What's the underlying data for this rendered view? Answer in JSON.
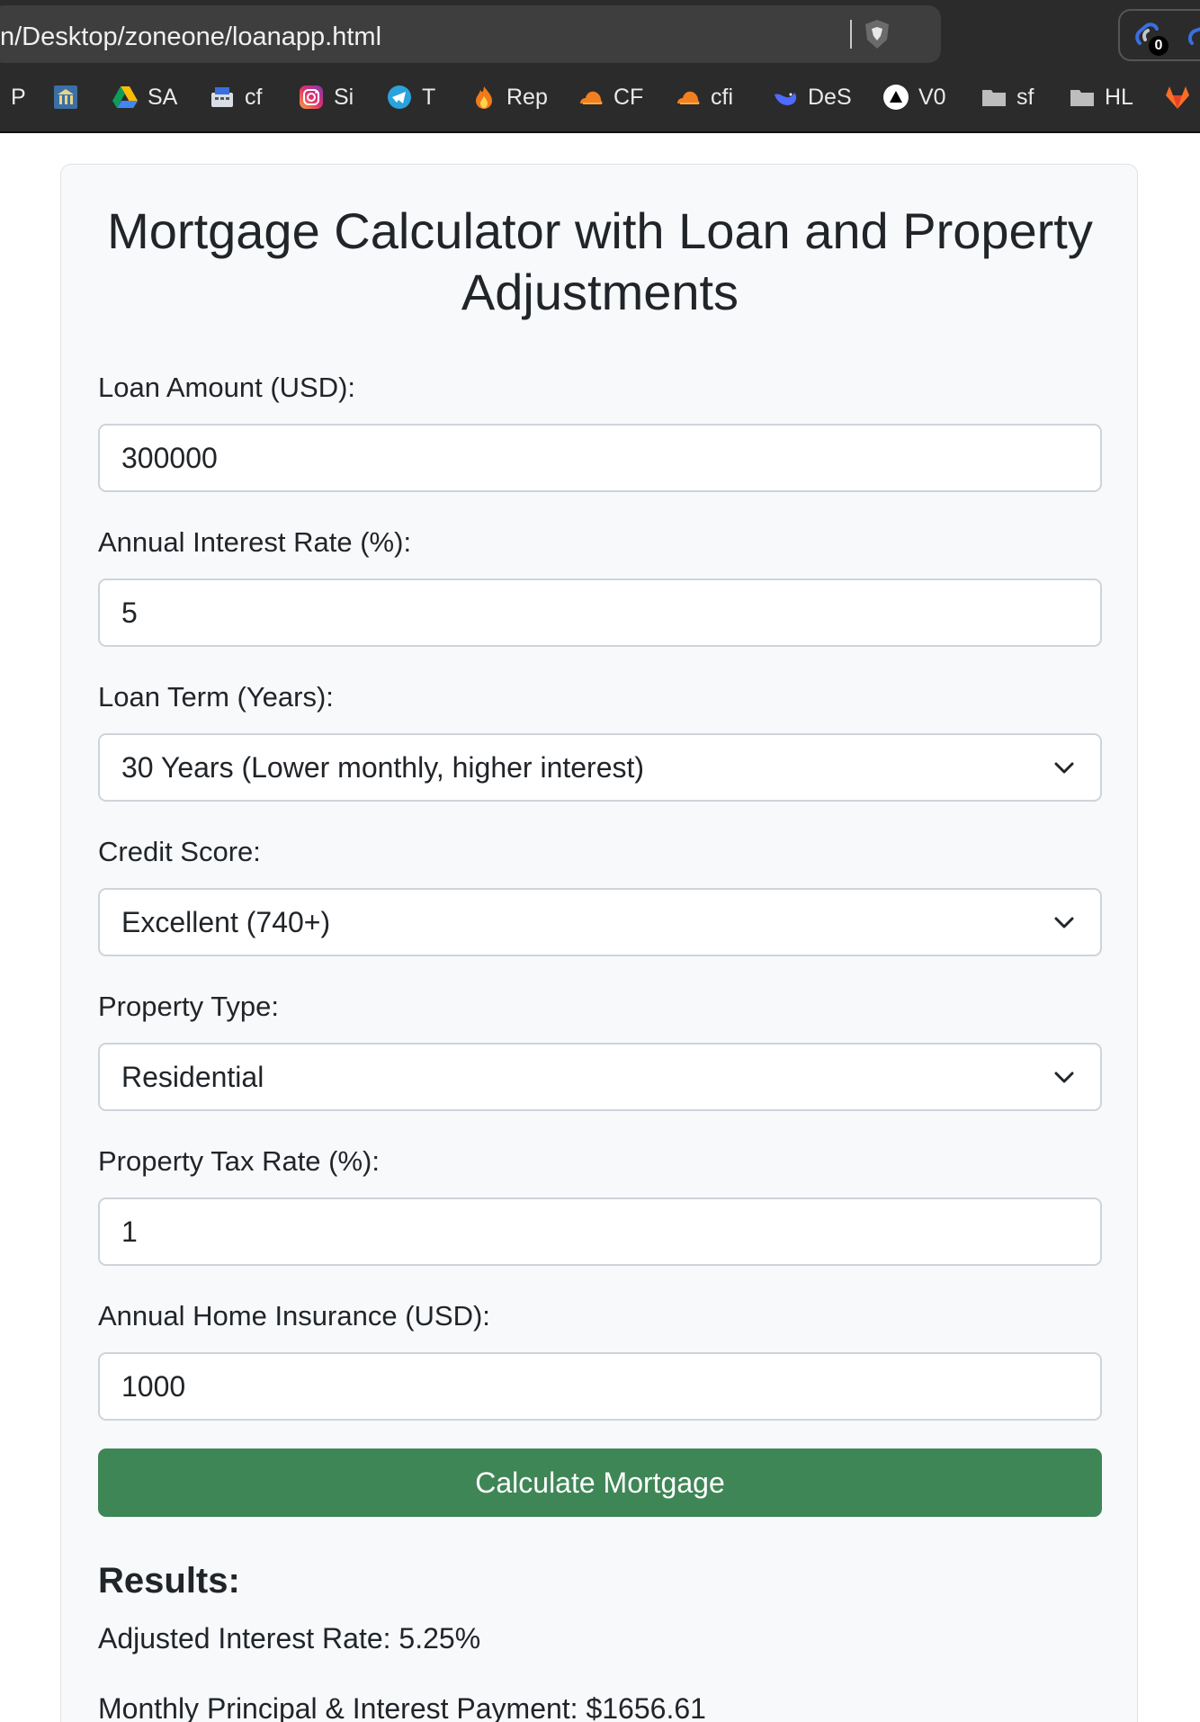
{
  "browser": {
    "url": "n/Desktop/zoneone/loanapp.html",
    "extension_badge": "0",
    "bookmarks": [
      {
        "label": "P",
        "icon": "bookmark-icon"
      },
      {
        "label": "",
        "icon": "building-icon"
      },
      {
        "label": "SA",
        "icon": "google-drive-icon"
      },
      {
        "label": "cf",
        "icon": "cash-register-icon"
      },
      {
        "label": "Si",
        "icon": "instagram-icon"
      },
      {
        "label": "T",
        "icon": "telegram-icon"
      },
      {
        "label": "Rep",
        "icon": "flame-icon"
      },
      {
        "label": "CF",
        "icon": "cloudflare-icon"
      },
      {
        "label": "cfi",
        "icon": "cloudflare-icon"
      },
      {
        "label": "DeS",
        "icon": "deepseek-icon"
      },
      {
        "label": "V0",
        "icon": "triangle-icon"
      },
      {
        "label": "sf",
        "icon": "folder-icon"
      },
      {
        "label": "HL",
        "icon": "folder-icon"
      },
      {
        "label": "",
        "icon": "gitlab-icon"
      }
    ]
  },
  "page": {
    "title": "Mortgage Calculator with Loan and Property Adjustments",
    "fields": {
      "loan_amount": {
        "label": "Loan Amount (USD):",
        "value": "300000"
      },
      "interest_rate": {
        "label": "Annual Interest Rate (%):",
        "value": "5"
      },
      "loan_term": {
        "label": "Loan Term (Years):",
        "value": "30 Years (Lower monthly, higher interest)"
      },
      "credit_score": {
        "label": "Credit Score:",
        "value": "Excellent (740+)"
      },
      "property_type": {
        "label": "Property Type:",
        "value": "Residential"
      },
      "property_tax": {
        "label": "Property Tax Rate (%):",
        "value": "1"
      },
      "home_insurance": {
        "label": "Annual Home Insurance (USD):",
        "value": "1000"
      }
    },
    "calculate_label": "Calculate Mortgage",
    "results": {
      "heading": "Results:",
      "adjusted_rate": "Adjusted Interest Rate: 5.25%",
      "monthly_pi": "Monthly Principal & Interest Payment: $1656.61"
    }
  },
  "colors": {
    "accent_button": "#3f8656",
    "chrome_background": "#2b2b2b",
    "card_background": "#f8f9fa"
  }
}
